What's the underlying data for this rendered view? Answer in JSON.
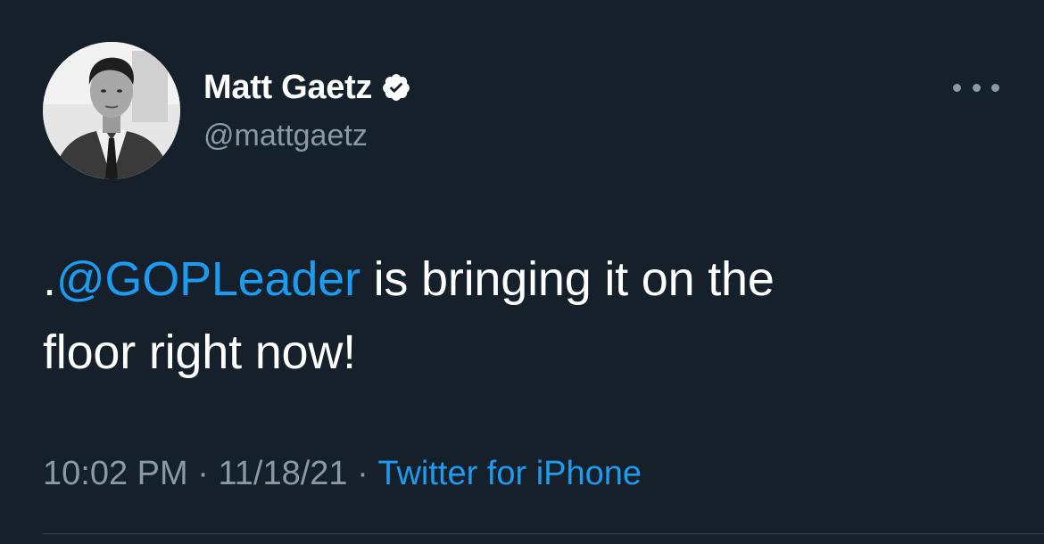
{
  "tweet": {
    "author": {
      "display_name": "Matt Gaetz",
      "handle": "@mattgaetz",
      "verified": true,
      "avatar_icon": "profile-photo"
    },
    "text_parts": {
      "prefix": ".",
      "mention": "@GOPLeader",
      "line1_rest": " is bringing it on the",
      "line2": "floor right now!"
    },
    "meta": {
      "time": "10:02 PM",
      "separator": " · ",
      "date": "11/18/21",
      "source": "Twitter for iPhone"
    },
    "more_icon": "more-horizontal-icon"
  },
  "colors": {
    "background": "#15202b",
    "primary_text": "#ffffff",
    "secondary_text": "#8b98a5",
    "link": "#1d9bf0",
    "divider": "#38444d"
  }
}
